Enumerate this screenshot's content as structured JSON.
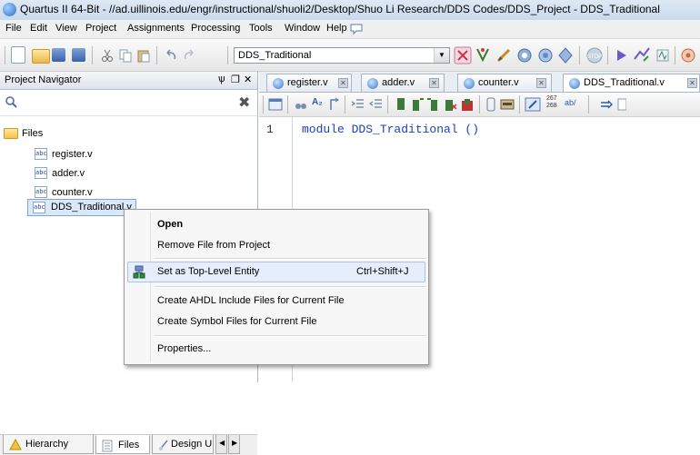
{
  "window": {
    "title": "Quartus II 64-Bit - //ad.uillinois.edu/engr/instructional/shuoli2/Desktop/Shuo Li Research/DDS Codes/DDS_Project - DDS_Traditional"
  },
  "menubar": {
    "items": [
      "File",
      "Edit",
      "View",
      "Project",
      "Assignments",
      "Processing",
      "Tools",
      "Window",
      "Help"
    ]
  },
  "toolbar": {
    "entity_value": "DDS_Traditional"
  },
  "navigator": {
    "title": "Project Navigator",
    "pin_glyph": "ѱ",
    "restore_glyph": "❐",
    "close_glyph": "✕",
    "clear_glyph": "✖",
    "root_label": "Files",
    "files": [
      "register.v",
      "adder.v",
      "counter.v",
      "DDS_Traditional.v"
    ],
    "tabs": [
      "Hierarchy",
      "Files",
      "Design Ui"
    ]
  },
  "editor": {
    "tabs": [
      "register.v",
      "adder.v",
      "counter.v",
      "DDS_Traditional.v"
    ],
    "lines": [
      {
        "number": "1",
        "text": "module DDS_Traditional ()"
      }
    ],
    "toolbar_numbers_top": "267",
    "toolbar_numbers_bottom": "268",
    "toolbar_ab": "ab/"
  },
  "context_menu": {
    "open": "Open",
    "remove": "Remove File from Project",
    "set_top": "Set as Top-Level Entity",
    "set_top_shortcut": "Ctrl+Shift+J",
    "create_ahdl": "Create AHDL Include Files for Current File",
    "create_symbol": "Create Symbol Files for Current File",
    "properties": "Properties..."
  },
  "colors": {
    "selection": "#dbe8fa",
    "menu_highlight": "#e6eefb",
    "keyword": "#1a3fbf"
  }
}
